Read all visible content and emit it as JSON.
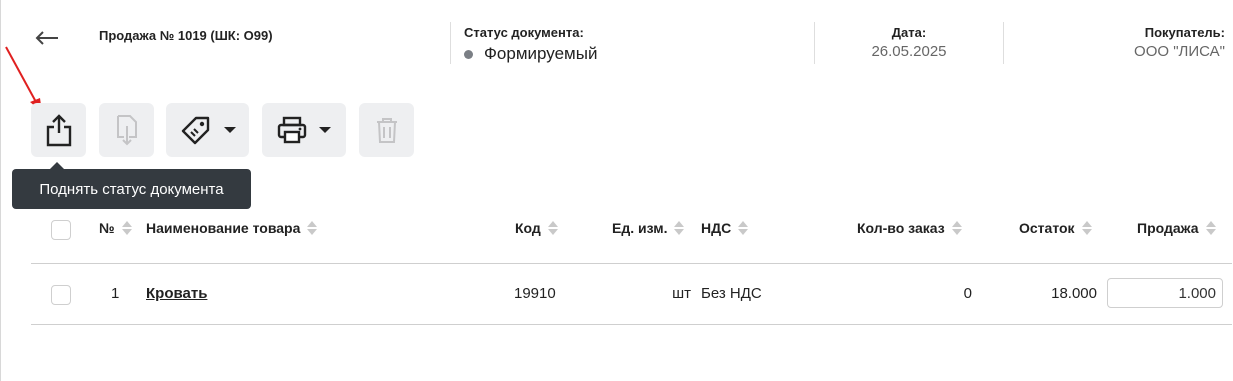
{
  "header": {
    "doc_title": "Продажа № 1019 (ШК: О99)",
    "status_label": "Статус документа:",
    "status_value": "Формируемый",
    "date_label": "Дата:",
    "date_value": "26.05.2025",
    "buyer_label": "Покупатель:",
    "buyer_value": "ООО \"ЛИСА\""
  },
  "toolbar": {
    "buttons": [
      {
        "name": "raise-status",
        "icon": "share-upload-icon",
        "enabled": true
      },
      {
        "name": "lower-status",
        "icon": "document-download-icon",
        "enabled": false
      },
      {
        "name": "labels",
        "icon": "tag-icon",
        "enabled": true,
        "dropdown": true
      },
      {
        "name": "print",
        "icon": "printer-icon",
        "enabled": true,
        "dropdown": true
      },
      {
        "name": "delete",
        "icon": "trash-icon",
        "enabled": false
      }
    ],
    "tooltip": "Поднять статус документа"
  },
  "table": {
    "columns": [
      "№",
      "Наименование товара",
      "Код",
      "Ед. изм.",
      "НДС",
      "Кол-во заказ",
      "Остаток",
      "Продажа"
    ],
    "rows": [
      {
        "num": "1",
        "name": "Кровать",
        "code": "19910",
        "unit": "шт",
        "vat": "Без НДС",
        "ordered": "0",
        "stock": "18.000",
        "sale": "1.000"
      }
    ]
  },
  "colors": {
    "status_dot": "#7b7f85",
    "tooltip_bg": "#343a40",
    "annotation_arrow": "#e02020",
    "button_bg": "#eeeff1"
  }
}
